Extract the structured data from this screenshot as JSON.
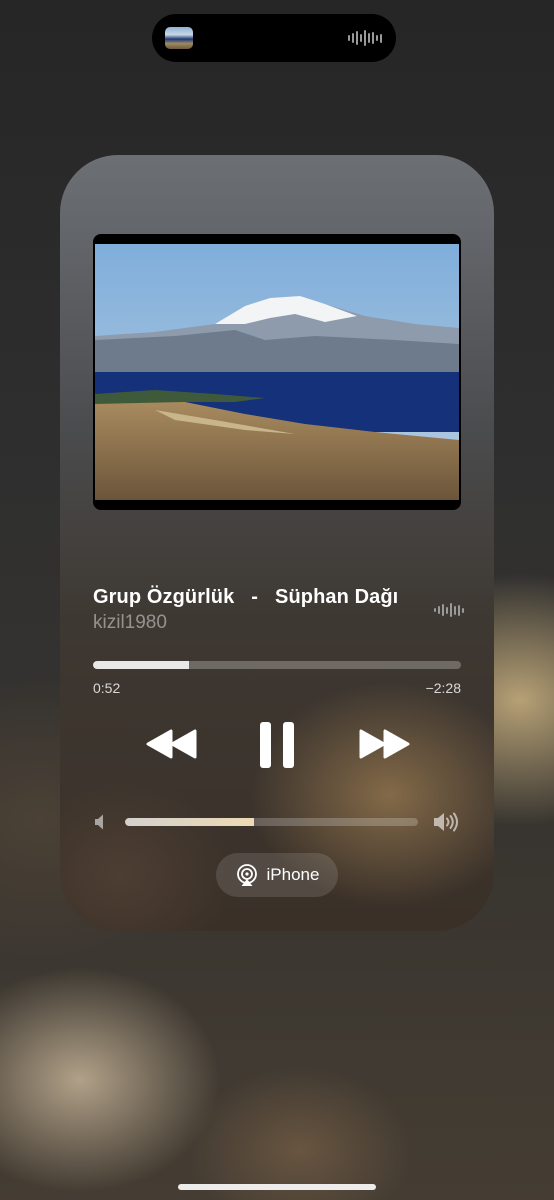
{
  "dynamic_island": {
    "artwork_icon": "album-art-thumbnail",
    "activity_icon": "audio-waveform-icon"
  },
  "now_playing": {
    "song_title": "Grup Özgürlük   -   Süphan Dağı",
    "artist": "kizil1980",
    "artwork_icon": "album-artwork-mountain-lake",
    "progress": 0.26,
    "elapsed": "0:52",
    "remaining": "−2:28"
  },
  "controls": {
    "rewind_icon": "rewind-icon",
    "play_pause_icon": "pause-icon",
    "forward_icon": "fast-forward-icon"
  },
  "volume": {
    "level": 0.44,
    "low_icon": "speaker-low-icon",
    "high_icon": "speaker-high-icon"
  },
  "output": {
    "route_icon": "airplay-audio-icon",
    "device_label": "iPhone"
  },
  "colors": {
    "accent_text": "#ffffff",
    "secondary_text": "rgba(255,255,255,0.45)"
  }
}
